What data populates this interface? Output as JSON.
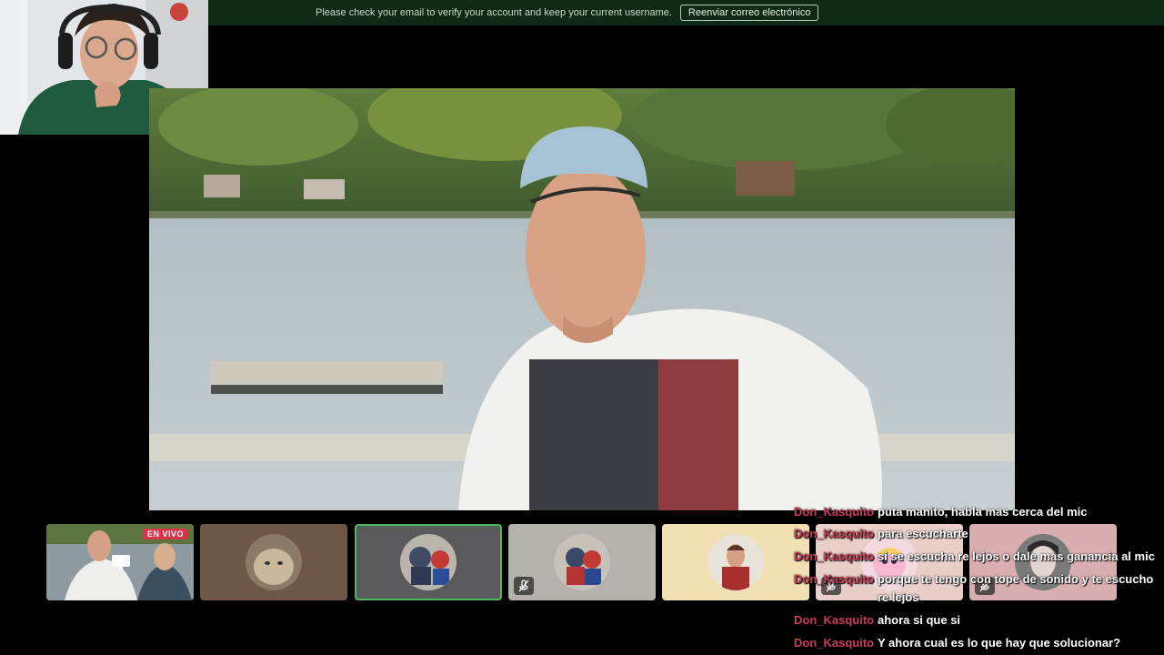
{
  "banner": {
    "message": "Please check your email to verify your account and keep your current username.",
    "button_label": "Reenviar correo electrónico"
  },
  "main_video": {
    "description_icon": "shared-screen-video"
  },
  "participants": [
    {
      "id": "p1",
      "type": "screen-share",
      "badge": "EN VIVO",
      "active": false
    },
    {
      "id": "p2",
      "type": "avatar",
      "muted": false,
      "active": false
    },
    {
      "id": "p3",
      "type": "avatar",
      "muted": false,
      "active": true
    },
    {
      "id": "p4",
      "type": "avatar",
      "muted": true,
      "active": false
    },
    {
      "id": "p5",
      "type": "avatar",
      "muted": false,
      "active": false
    },
    {
      "id": "p6",
      "type": "avatar",
      "muted": true,
      "active": false
    },
    {
      "id": "p7",
      "type": "avatar",
      "muted": true,
      "active": false
    }
  ],
  "chat": [
    {
      "user": "Don_Kasquito",
      "message": "puta manito, habla mas cerca del mic"
    },
    {
      "user": "Don_Kasquito",
      "message": "para escucharte"
    },
    {
      "user": "Don_Kasquito",
      "message": "si se escucha re lejos o dale mas ganancia al mic"
    },
    {
      "user": "Don_Kasquito",
      "message": "porque te tengo con tope de sonido y te escucho re lejos"
    },
    {
      "user": "Don_Kasquito",
      "message": "ahora si que si"
    },
    {
      "user": "Don_Kasquito",
      "message": "Y ahora cual es lo que hay que solucionar?"
    }
  ],
  "colors": {
    "banner_bg": "#0e2a14",
    "live_badge": "#d8334a",
    "chat_username": "#c83d57",
    "active_border": "#4bb860"
  }
}
